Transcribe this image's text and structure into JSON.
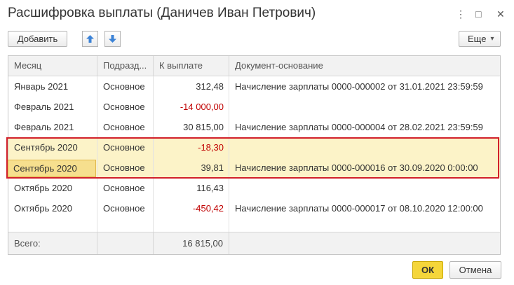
{
  "window": {
    "title": "Расшифровка выплаты (Даничев Иван Петрович)",
    "menu_icon": "⋮",
    "maximize_icon": "□",
    "close_icon": "✕"
  },
  "toolbar": {
    "add_label": "Добавить",
    "more_label": "Еще",
    "more_arrow": "▾"
  },
  "table": {
    "columns": [
      "Месяц",
      "Подразд...",
      "К выплате",
      "Документ-основание"
    ],
    "rows": [
      {
        "month": "Январь 2021",
        "dept": "Основное",
        "amount": "312,48",
        "doc": "Начисление зарплаты 0000-000002 от 31.01.2021 23:59:59"
      },
      {
        "month": "Февраль 2021",
        "dept": "Основное",
        "amount": "-14 000,00",
        "doc": ""
      },
      {
        "month": "Февраль 2021",
        "dept": "Основное",
        "amount": "30 815,00",
        "doc": "Начисление зарплаты 0000-000004 от 28.02.2021 23:59:59"
      },
      {
        "month": "Сентябрь 2020",
        "dept": "Основное",
        "amount": "-18,30",
        "doc": ""
      },
      {
        "month": "Сентябрь 2020",
        "dept": "Основное",
        "amount": "39,81",
        "doc": "Начисление зарплаты 0000-000016 от 30.09.2020 0:00:00"
      },
      {
        "month": "Октябрь 2020",
        "dept": "Основное",
        "amount": "116,43",
        "doc": ""
      },
      {
        "month": "Октябрь 2020",
        "dept": "Основное",
        "amount": "-450,42",
        "doc": "Начисление зарплаты 0000-000017 от 08.10.2020 12:00:00"
      }
    ],
    "footer": {
      "label": "Всего:",
      "total": "16 815,00"
    }
  },
  "buttons": {
    "ok": "ОК",
    "cancel": "Отмена"
  },
  "colors": {
    "negative": "#c00000",
    "highlight_row": "#fcf3c8",
    "selection_frame": "#d2202a",
    "primary_button": "#f5d63a"
  }
}
